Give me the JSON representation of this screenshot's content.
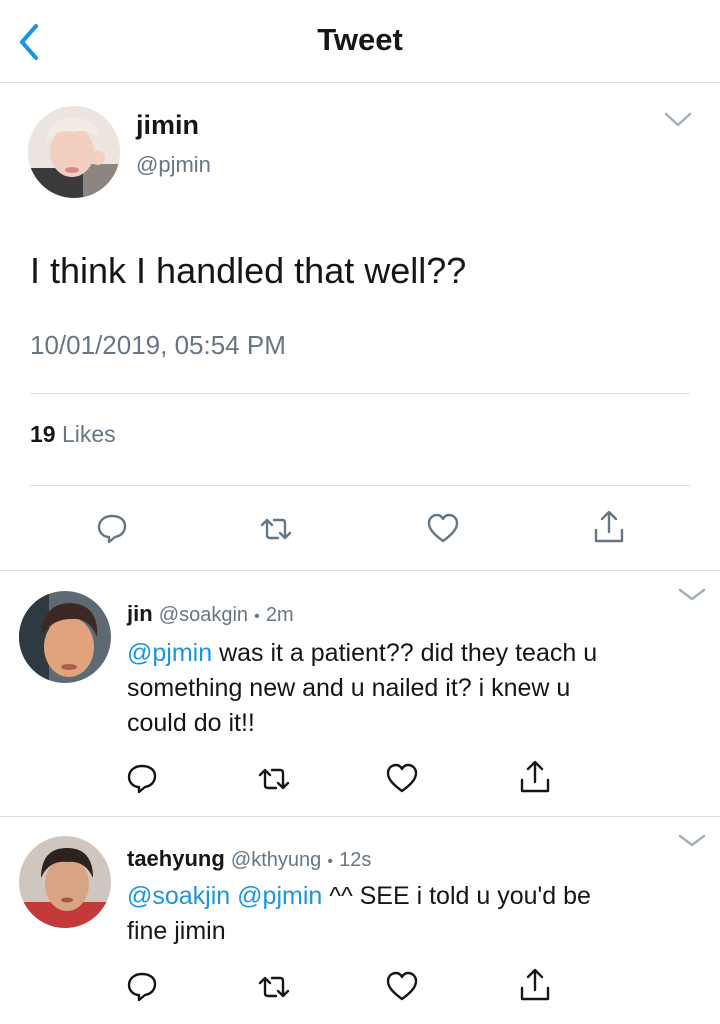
{
  "nav": {
    "title": "Tweet"
  },
  "tweet": {
    "name": "jimin",
    "handle": "@pjmin",
    "text": "I think I handled that well??",
    "timestamp": "10/01/2019, 05:54 PM",
    "likes_count": "19",
    "likes_label": "Likes"
  },
  "replies": [
    {
      "name": "jin",
      "handle": "@soakgin",
      "time": "2m",
      "mentions": [
        "@pjmin"
      ],
      "text_line1": " was it a patient?? did they teach u",
      "text_line2": "something new and u nailed it? i knew u",
      "text_line3": "could do it!!"
    },
    {
      "name": "taehyung",
      "handle": "@kthyung",
      "time": "12s",
      "mentions": [
        "@soakjin",
        "@pjmin"
      ],
      "text_line1": " ^^ SEE i told u you'd be",
      "text_line2": "fine jimin"
    }
  ],
  "separator": "•",
  "colors": {
    "accent": "#1b95e0",
    "muted": "#657786",
    "icon": "#657786",
    "divider": "#d8dde1"
  },
  "icons": [
    "back-chevron-icon",
    "chevron-down-icon",
    "reply-icon",
    "retweet-icon",
    "like-icon",
    "share-icon"
  ]
}
